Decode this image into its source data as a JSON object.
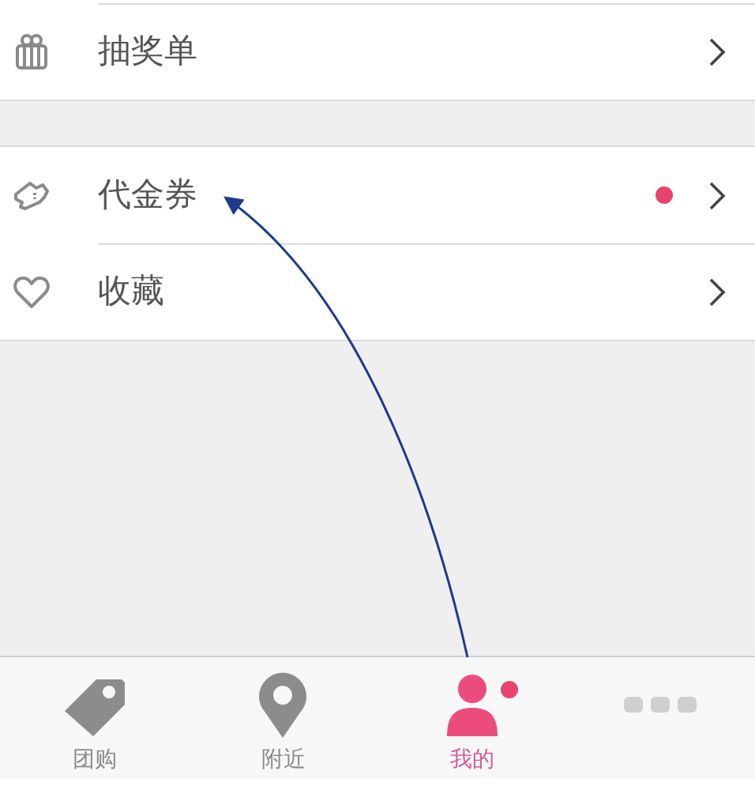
{
  "menu_groups": [
    {
      "items": [
        {
          "kind": "gift",
          "label": "抽奖单",
          "badge_dot": false
        }
      ]
    },
    {
      "items": [
        {
          "kind": "ticket",
          "label": "代金券",
          "badge_dot": true
        },
        {
          "kind": "heart",
          "label": "收藏",
          "badge_dot": false
        }
      ]
    }
  ],
  "tab_bar": [
    {
      "kind": "tag",
      "label": "团购",
      "selected": false,
      "badge_dot": false
    },
    {
      "kind": "pin",
      "label": "附近",
      "selected": false,
      "badge_dot": false
    },
    {
      "kind": "person",
      "label": "我的",
      "selected": true,
      "badge_dot": true
    },
    {
      "kind": "more",
      "selected": false,
      "badge_dot": false
    }
  ]
}
